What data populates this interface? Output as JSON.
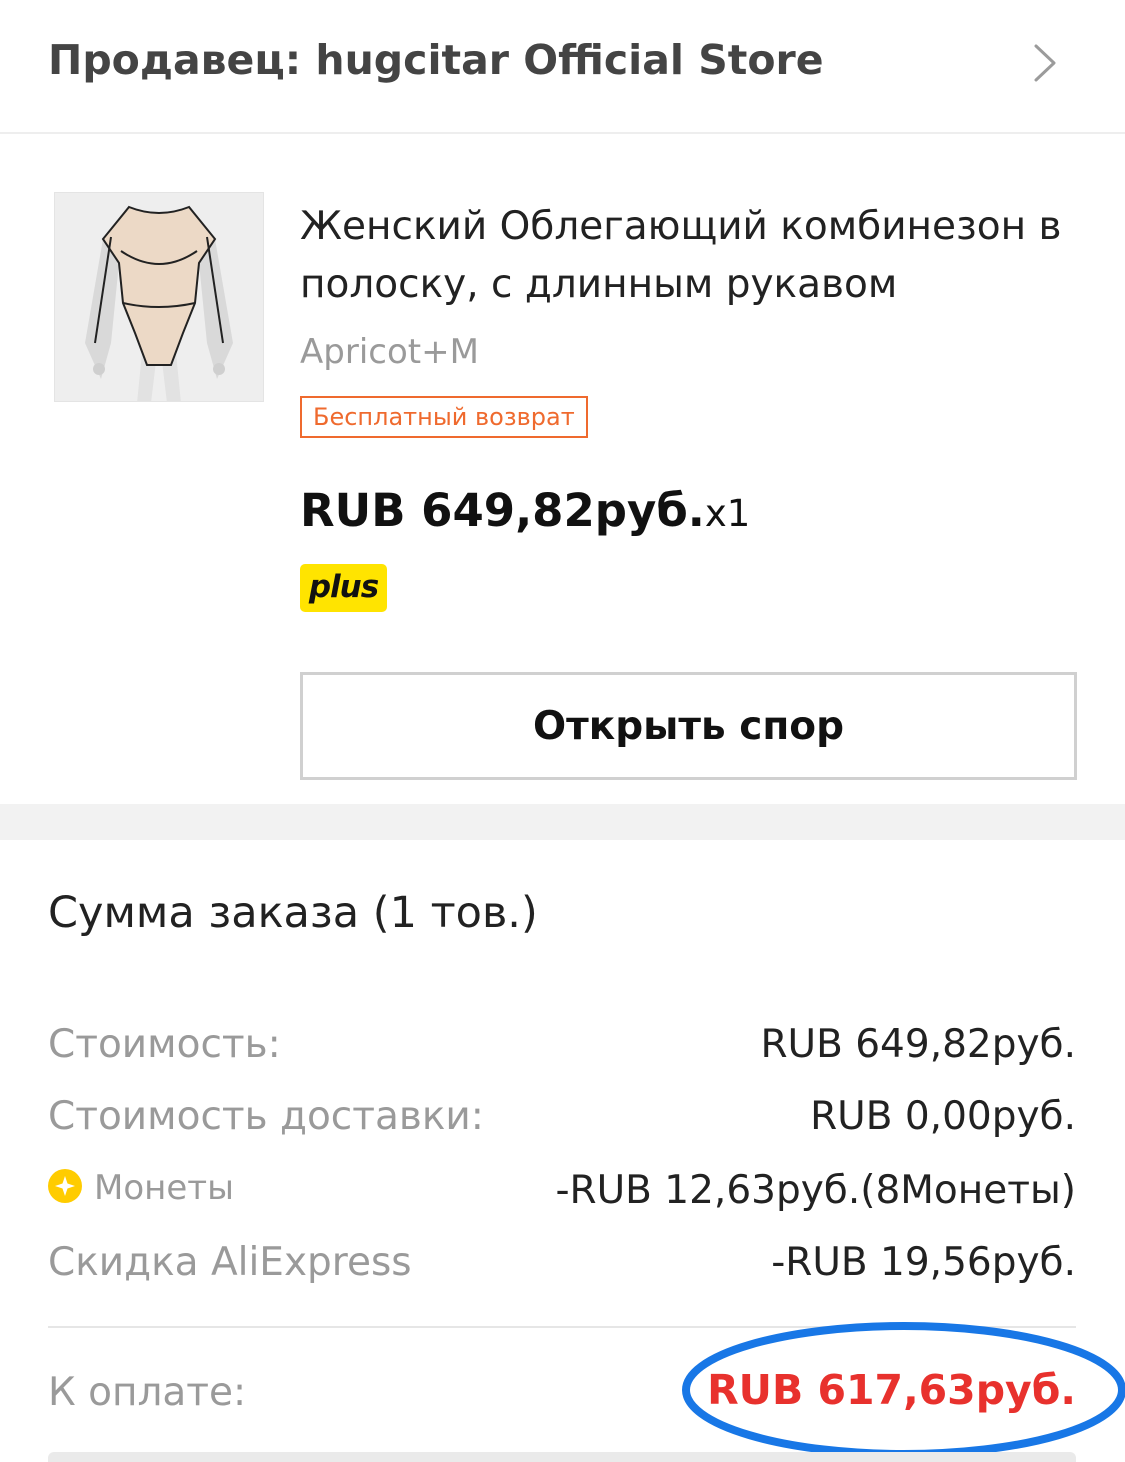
{
  "seller": {
    "title": "Продавец: hugcitar Official Store",
    "chevron_icon": "chevron-right-icon"
  },
  "product": {
    "name": "Женский Облегающий комбинезон в полоску, с длинным рукавом",
    "variant": "Apricot+M",
    "return_badge": "Бесплатный возврат",
    "price": "RUB 649,82руб.",
    "quantity": "x1",
    "plus_badge": "plus",
    "dispute_button": "Открыть спор"
  },
  "summary": {
    "title": "Сумма заказа (1 тов.)",
    "rows": [
      {
        "label": "Стоимость:",
        "value": "RUB 649,82руб."
      },
      {
        "label": "Стоимость доставки:",
        "value": "RUB 0,00руб."
      },
      {
        "label": "Монеты",
        "value": "-RUB 12,63руб.(8Монеты)",
        "icon": "coin-icon"
      },
      {
        "label": "Скидка AliExpress",
        "value": "-RUB 19,56руб."
      }
    ],
    "total_label": "К оплате:",
    "total_value": "RUB 617,63руб."
  },
  "colors": {
    "accent_orange": "#ef6a2e",
    "total_red": "#e8312d",
    "plus_yellow": "#ffe400",
    "annotation_blue": "#1877e6"
  }
}
